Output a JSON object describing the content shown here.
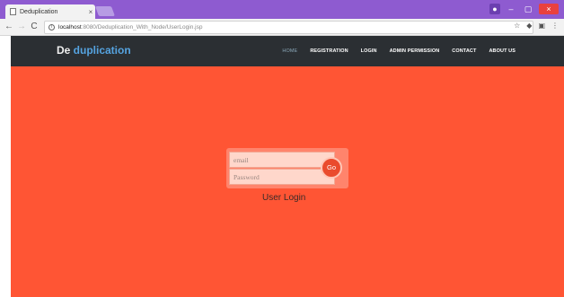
{
  "browser": {
    "tab_title": "Deduplication",
    "tab_close": "×",
    "url_host": "localhost",
    "url_path": ":8080/Deduplication_With_Node/UserLogin.jsp",
    "window_controls": {
      "minimize": "–",
      "maximize": "▢",
      "close": "×"
    }
  },
  "navbar": {
    "brand_first": "De",
    "brand_second": " duplication",
    "menu": [
      {
        "label": "HOME",
        "active": true
      },
      {
        "label": "REGISTRATION",
        "active": false
      },
      {
        "label": "LOGIN",
        "active": false
      },
      {
        "label": "ADMIN PERMISSION",
        "active": false
      },
      {
        "label": "CONTACT",
        "active": false
      },
      {
        "label": "ABOUT US",
        "active": false
      }
    ]
  },
  "login": {
    "email_placeholder": "email",
    "password_placeholder": "Password",
    "go_label": "Go",
    "title": "User Login"
  },
  "colors": {
    "page_background": "#ff5534",
    "navbar_background": "#2b2f33",
    "brand_accent": "#55a3e0",
    "titlebar": "#8e5bd0"
  },
  "icons": {
    "back": "back-arrow-icon",
    "forward": "forward-arrow-icon",
    "reload": "reload-icon",
    "info": "info-icon",
    "star": "star-icon",
    "menu": "kebab-menu-icon"
  }
}
